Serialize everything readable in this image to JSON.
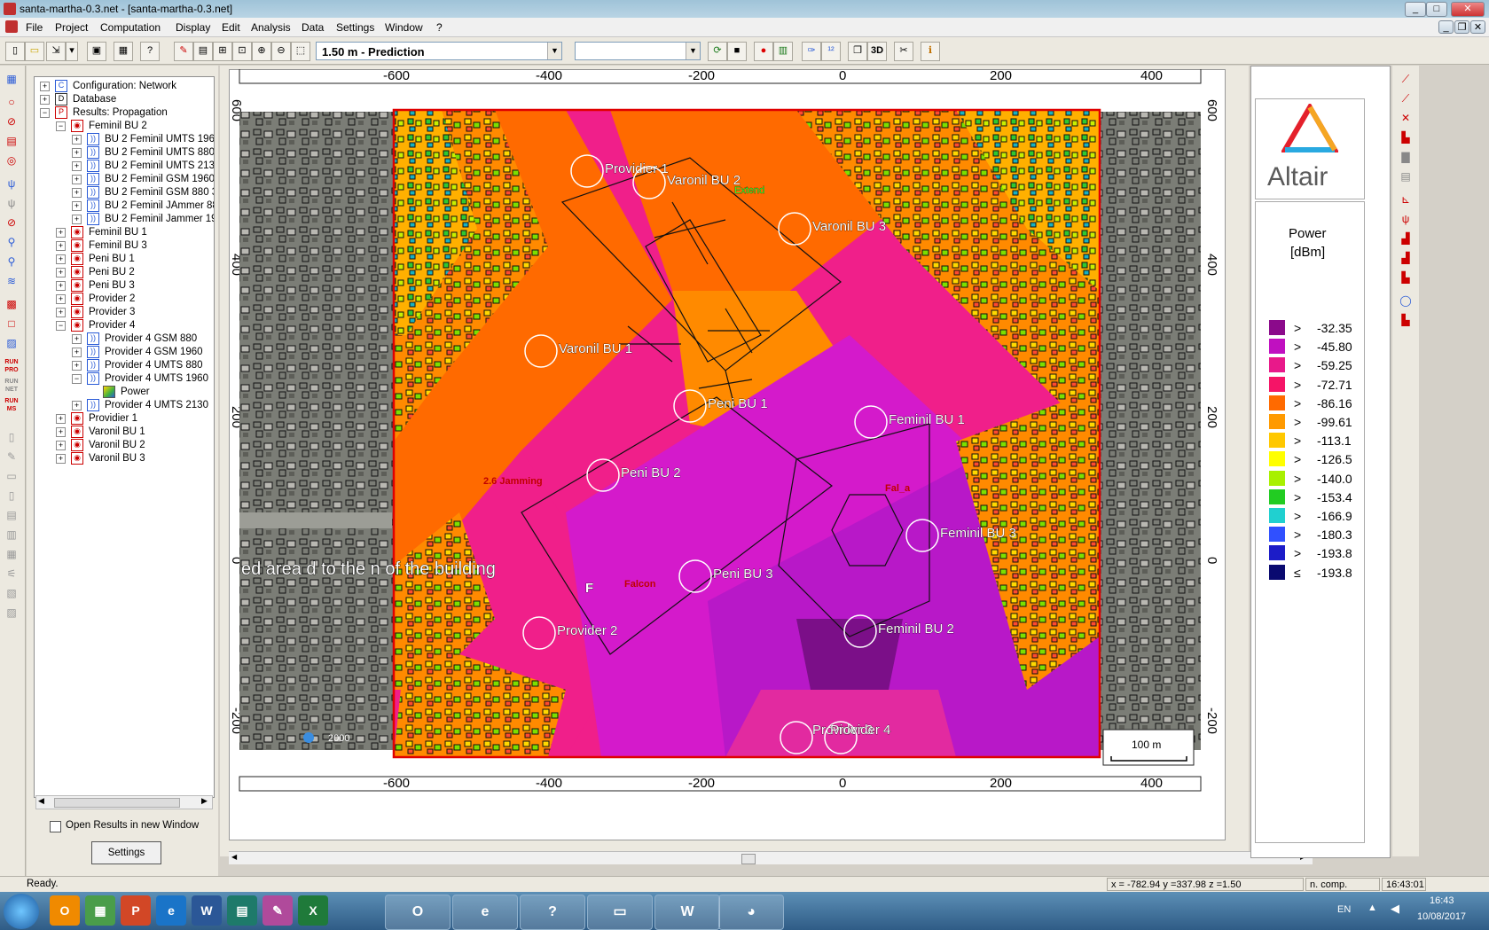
{
  "window": {
    "title": "santa-martha-0.3.net - [santa-martha-0.3.net]"
  },
  "menu": [
    "File",
    "Project",
    "Computation",
    "Display",
    "Edit",
    "Analysis",
    "Data",
    "Settings",
    "Window",
    "?"
  ],
  "toolbar": {
    "layer_select": "1.50 m - Prediction",
    "second_select": "",
    "btn_3d": "3D"
  },
  "tree": [
    {
      "label": "Configuration: Network",
      "level": 0,
      "expander": "+",
      "icon": "C",
      "iconstyle": "blue"
    },
    {
      "label": "Database",
      "level": 0,
      "expander": "+",
      "icon": "D",
      "iconstyle": ""
    },
    {
      "label": "Results: Propagation",
      "level": 0,
      "expander": "−",
      "icon": "P",
      "iconstyle": "red"
    },
    {
      "label": "Feminil  BU 2",
      "level": 1,
      "expander": "−",
      "icon": "◉",
      "iconstyle": "red"
    },
    {
      "label": "BU 2 Feminil UMTS 1960",
      "level": 2,
      "expander": "+",
      "icon": "((·))",
      "iconstyle": "blue"
    },
    {
      "label": "BU 2 Feminil UMTS 880 3",
      "level": 2,
      "expander": "+",
      "icon": "((·))",
      "iconstyle": "blue"
    },
    {
      "label": "BU 2 Feminil UMTS 2130",
      "level": 2,
      "expander": "+",
      "icon": "((·))",
      "iconstyle": "blue"
    },
    {
      "label": "BU 2 Feminil GSM 1960 3",
      "level": 2,
      "expander": "+",
      "icon": "((·))",
      "iconstyle": "blue"
    },
    {
      "label": "BU 2 Feminil GSM 880 34",
      "level": 2,
      "expander": "+",
      "icon": "((·))",
      "iconstyle": "blue"
    },
    {
      "label": "BU 2 Feminil JAmmer 880",
      "level": 2,
      "expander": "+",
      "icon": "((·))",
      "iconstyle": "blue"
    },
    {
      "label": "BU 2 Feminil Jammer 1960",
      "level": 2,
      "expander": "+",
      "icon": "((·))",
      "iconstyle": "blue"
    },
    {
      "label": "Feminil BU 1",
      "level": 1,
      "expander": "+",
      "icon": "◉",
      "iconstyle": "red"
    },
    {
      "label": "Feminil BU 3",
      "level": 1,
      "expander": "+",
      "icon": "◉",
      "iconstyle": "red"
    },
    {
      "label": "Peni  BU 1",
      "level": 1,
      "expander": "+",
      "icon": "◉",
      "iconstyle": "red"
    },
    {
      "label": "Peni  BU 2",
      "level": 1,
      "expander": "+",
      "icon": "◉",
      "iconstyle": "red"
    },
    {
      "label": "Peni  BU 3",
      "level": 1,
      "expander": "+",
      "icon": "◉",
      "iconstyle": "red"
    },
    {
      "label": "Provider 2",
      "level": 1,
      "expander": "+",
      "icon": "◉",
      "iconstyle": "red"
    },
    {
      "label": "Provider 3",
      "level": 1,
      "expander": "+",
      "icon": "◉",
      "iconstyle": "red"
    },
    {
      "label": "Provider 4",
      "level": 1,
      "expander": "−",
      "icon": "◉",
      "iconstyle": "red"
    },
    {
      "label": "Provider 4 GSM 880",
      "level": 2,
      "expander": "+",
      "icon": "((·))",
      "iconstyle": "blue"
    },
    {
      "label": "Provider 4 GSM 1960",
      "level": 2,
      "expander": "+",
      "icon": "((·))",
      "iconstyle": "blue"
    },
    {
      "label": "Provider 4 UMTS 880",
      "level": 2,
      "expander": "+",
      "icon": "((·))",
      "iconstyle": "blue"
    },
    {
      "label": "Provider 4 UMTS 1960",
      "level": 2,
      "expander": "−",
      "icon": "((·))",
      "iconstyle": "blue"
    },
    {
      "label": "Power",
      "level": 3,
      "expander": "",
      "icon": "",
      "iconstyle": "pow"
    },
    {
      "label": "Provider 4 UMTS 2130",
      "level": 2,
      "expander": "+",
      "icon": "((·))",
      "iconstyle": "blue"
    },
    {
      "label": "Providier 1",
      "level": 1,
      "expander": "+",
      "icon": "◉",
      "iconstyle": "red"
    },
    {
      "label": "Varonil  BU 1",
      "level": 1,
      "expander": "+",
      "icon": "◉",
      "iconstyle": "red"
    },
    {
      "label": "Varonil  BU 2",
      "level": 1,
      "expander": "+",
      "icon": "◉",
      "iconstyle": "red"
    },
    {
      "label": "Varonil  BU 3",
      "level": 1,
      "expander": "+",
      "icon": "◉",
      "iconstyle": "red"
    }
  ],
  "panel": {
    "open_results_label": "Open Results in new Window",
    "settings_button": "Settings"
  },
  "map": {
    "x_ticks": [
      "-600",
      "-400",
      "-200",
      "0",
      "200",
      "400"
    ],
    "y_ticks": [
      "600",
      "400",
      "200",
      "0",
      "-200"
    ],
    "scale_label": "100 m",
    "imagery_year": "2000",
    "overlay_text": "ed area d    to the       n of the building",
    "annotations": [
      "Extend",
      "2.6 Jamming",
      "Falcon",
      "Fal_a",
      "F"
    ],
    "sites": [
      {
        "label": "Providier 1"
      },
      {
        "label": "Varonil  BU 2"
      },
      {
        "label": "Varonil  BU 3"
      },
      {
        "label": "Varonil  BU 1"
      },
      {
        "label": "Peni  BU 1"
      },
      {
        "label": "Feminil  BU 1"
      },
      {
        "label": "Peni  BU 2"
      },
      {
        "label": "Feminil  BU 3"
      },
      {
        "label": "Peni  BU 3"
      },
      {
        "label": "Provider 2"
      },
      {
        "label": "Feminil  BU 2"
      },
      {
        "label": "Provider 3"
      },
      {
        "label": "Provider 4"
      }
    ]
  },
  "legend": {
    "brand": "Altair",
    "title": "Power",
    "unit": "[dBm]",
    "entries": [
      {
        "op": ">",
        "value": "-32.35",
        "color": "#8b0a8b"
      },
      {
        "op": ">",
        "value": "-45.80",
        "color": "#c010c0"
      },
      {
        "op": ">",
        "value": "-59.25",
        "color": "#e8198a"
      },
      {
        "op": ">",
        "value": "-72.71",
        "color": "#f51467"
      },
      {
        "op": ">",
        "value": "-86.16",
        "color": "#ff6a00"
      },
      {
        "op": ">",
        "value": "-99.61",
        "color": "#ff9a00"
      },
      {
        "op": ">",
        "value": "-113.1",
        "color": "#ffc800"
      },
      {
        "op": ">",
        "value": "-126.5",
        "color": "#ffff00"
      },
      {
        "op": ">",
        "value": "-140.0",
        "color": "#a8f000"
      },
      {
        "op": ">",
        "value": "-153.4",
        "color": "#22cc22"
      },
      {
        "op": ">",
        "value": "-166.9",
        "color": "#20d0d0"
      },
      {
        "op": ">",
        "value": "-180.3",
        "color": "#3050ff"
      },
      {
        "op": ">",
        "value": "-193.8",
        "color": "#1c1cc8"
      },
      {
        "op": "≤",
        "value": "-193.8",
        "color": "#0a0a70"
      }
    ]
  },
  "status": {
    "ready": "Ready.",
    "coords": "x = -782.94 y =337.98 z =1.50",
    "comp": "n. comp.",
    "time": "16:43:01"
  },
  "taskbar": {
    "lang": "EN",
    "clock_time": "16:43",
    "clock_date": "10/08/2017"
  }
}
